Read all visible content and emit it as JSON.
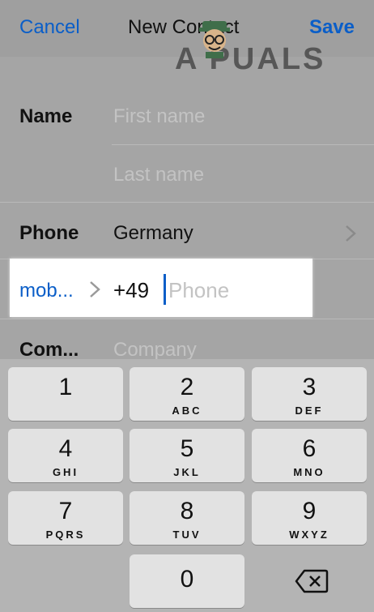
{
  "nav": {
    "cancel_label": "Cancel",
    "title": "New Contact",
    "save_label": "Save"
  },
  "watermark": {
    "text": "A  PUALS",
    "icon": "mascot-icon"
  },
  "form": {
    "name_label": "Name",
    "first_name_placeholder": "First name",
    "last_name_placeholder": "Last name",
    "phone_label": "Phone",
    "country_value": "Germany",
    "phone_type_label": "mob...",
    "country_code": "+49",
    "phone_placeholder": "Phone",
    "company_label": "Com...",
    "company_placeholder": "Company"
  },
  "keypad": {
    "keys": [
      {
        "num": "1",
        "letters": ""
      },
      {
        "num": "2",
        "letters": "ABC"
      },
      {
        "num": "3",
        "letters": "DEF"
      },
      {
        "num": "4",
        "letters": "GHI"
      },
      {
        "num": "5",
        "letters": "JKL"
      },
      {
        "num": "6",
        "letters": "MNO"
      },
      {
        "num": "7",
        "letters": "PQRS"
      },
      {
        "num": "8",
        "letters": "TUV"
      },
      {
        "num": "9",
        "letters": "WXYZ"
      },
      {
        "num": "0",
        "letters": ""
      }
    ],
    "backspace_icon": "backspace-icon"
  },
  "colors": {
    "accent": "#0a5ec8",
    "overlay": "#a5a5a5",
    "highlight": "#ffffff",
    "key": "#e2e2e2",
    "keyboard_bg": "#b4b4b4"
  }
}
